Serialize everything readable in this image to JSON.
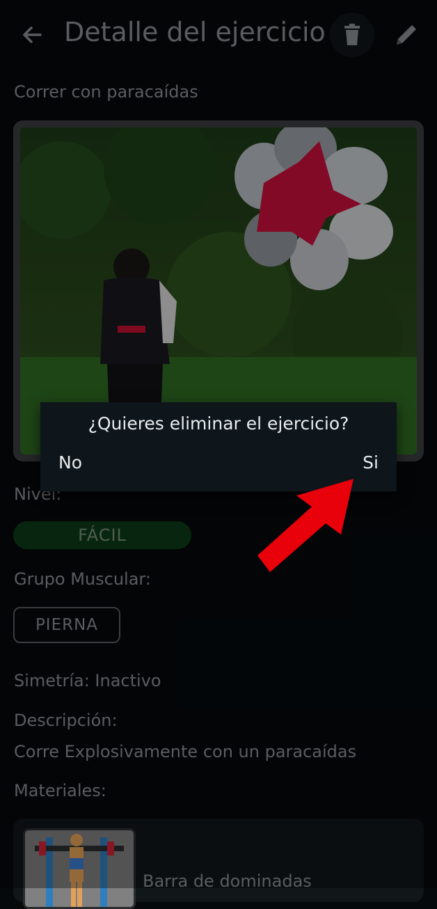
{
  "appbar": {
    "title": "Detalle del ejercicio",
    "back_icon": "arrow-left-icon",
    "delete_icon": "trash-icon",
    "edit_icon": "pencil-icon"
  },
  "exercise": {
    "name": "Correr con paracaídas",
    "image_desc": "person running with parachute"
  },
  "level": {
    "label": "Nivel:",
    "value": "FÁCIL",
    "color": "#0d3b17"
  },
  "muscle": {
    "label": "Grupo Muscular:",
    "value": "PIERNA"
  },
  "symmetry": {
    "text": "Simetría: Inactivo"
  },
  "description": {
    "label": "Descripción:",
    "text": "Corre Explosivamente con un paracaídas"
  },
  "materials": {
    "label": "Materiales:",
    "items": [
      {
        "name": "Barra de dominadas",
        "icon": "pull-up-bar-icon"
      }
    ]
  },
  "dialog": {
    "title": "¿Quieres eliminar el ejercicio?",
    "no_label": "No",
    "yes_label": "Si"
  },
  "annotation": {
    "arrow_color": "#e8000a"
  }
}
